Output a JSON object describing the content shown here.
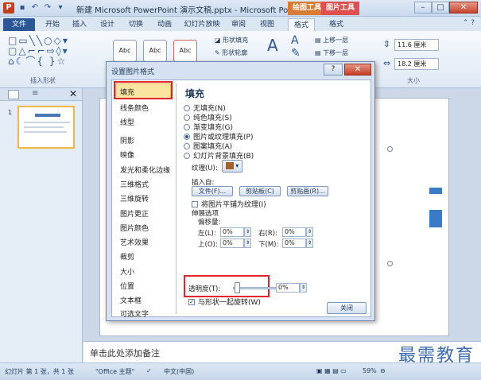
{
  "titlebar": {
    "title": "新建 Microsoft PowerPoint 演示文稿.pptx - Microsoft PowerPo...",
    "context_tab_drawing": "绘图工具",
    "context_tab_picture": "图片工具",
    "minimize": "–",
    "maximize": "□",
    "close": "✕"
  },
  "tabs": [
    "文件",
    "开始",
    "插入",
    "设计",
    "切换",
    "动画",
    "幻灯片放映",
    "审阅",
    "视图",
    "格式",
    "格式"
  ],
  "ribbon": {
    "insert_shapes_label": "插入形状",
    "shape_style_samples": [
      "Abc",
      "Abc",
      "Abc"
    ],
    "shape_fill": "形状填充",
    "shape_outline": "形状轮廓",
    "bring_forward": "上移一层",
    "send_backward": "下移一层",
    "height_value": "11.6 厘米",
    "width_value": "18.2 厘米",
    "size_label": "大小"
  },
  "slide_pane": {
    "slide_number": "1"
  },
  "notes_placeholder": "单击此处添加备注",
  "watermark": "最需教育",
  "statusbar": {
    "slide_info": "幻灯片 第 1 张，共 1 张",
    "theme": "\"Office 主题\"",
    "language": "中文(中国)",
    "zoom": "59%"
  },
  "dialog": {
    "title": "设置图片格式",
    "help": "?",
    "close": "✕",
    "categories": [
      "填充",
      "线条颜色",
      "线型",
      "阴影",
      "映像",
      "发光和柔化边缘",
      "三维格式",
      "三维旋转",
      "图片更正",
      "图片颜色",
      "艺术效果",
      "裁剪",
      "大小",
      "位置",
      "文本框",
      "可选文字"
    ],
    "section_title": "填充",
    "fill_options": [
      "无填充(N)",
      "纯色填充(S)",
      "渐变填充(G)",
      "图片或纹理填充(P)",
      "图案填充(A)",
      "幻灯片背景填充(B)"
    ],
    "texture_label": "纹理(U):",
    "insert_from_label": "插入自:",
    "file_button": "文件(F)...",
    "clipboard_button": "剪贴板(C)",
    "clipart_button": "剪贴画(R)...",
    "tile_checkbox": "将图片平铺为纹理(I)",
    "stretch_options": "伸展选项",
    "offsets_label": "偏移量:",
    "left_label": "左(L):",
    "right_label": "右(R):",
    "top_label": "上(O):",
    "bottom_label": "下(M):",
    "offset_left": "0%",
    "offset_right": "0%",
    "offset_top": "0%",
    "offset_bottom": "0%",
    "transparency_label": "透明度(T):",
    "transparency_value": "0%",
    "rotate_checkbox": "与形状一起旋转(W)",
    "close_button": "关闭"
  }
}
